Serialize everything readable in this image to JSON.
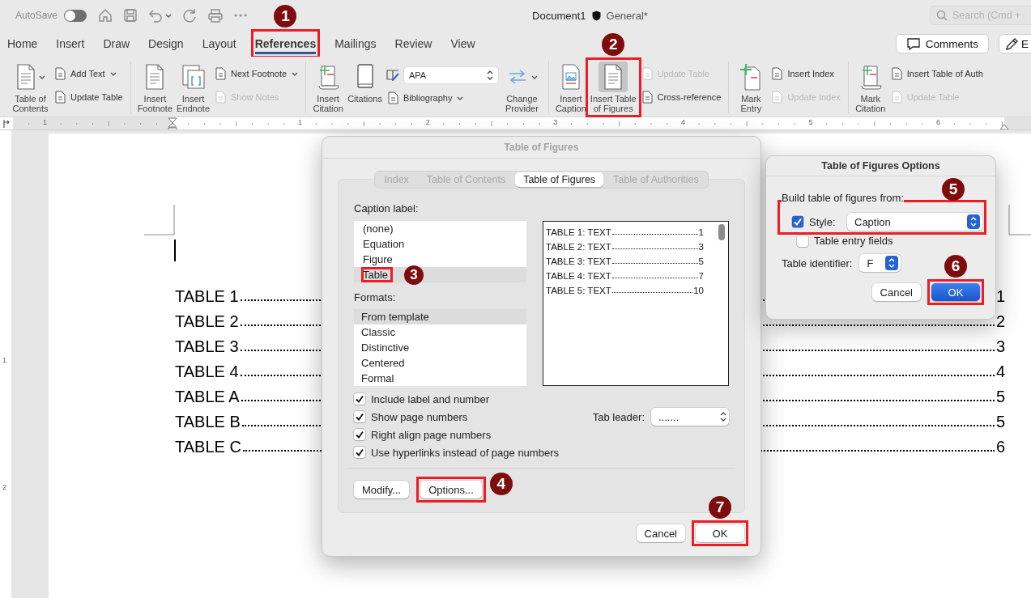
{
  "title_bar": {
    "autosave_label": "AutoSave",
    "autosave_on": false,
    "document_name": "Document1",
    "sensitivity": "General*",
    "search_placeholder": "Search (Cmd +"
  },
  "tabs": [
    {
      "label": "Home",
      "selected": false
    },
    {
      "label": "Insert",
      "selected": false
    },
    {
      "label": "Draw",
      "selected": false
    },
    {
      "label": "Design",
      "selected": false
    },
    {
      "label": "Layout",
      "selected": false
    },
    {
      "label": "References",
      "selected": true,
      "annotation": {
        "number": "1"
      }
    },
    {
      "label": "Mailings",
      "selected": false
    },
    {
      "label": "Review",
      "selected": false
    },
    {
      "label": "View",
      "selected": false
    }
  ],
  "header_buttons": [
    {
      "kind": "comments",
      "label": "Comments"
    },
    {
      "kind": "edit",
      "label": "E"
    }
  ],
  "ribbon": {
    "groups": [
      {
        "columns": [
          {
            "kind": "large",
            "label": "Table of\nContents",
            "caret": true,
            "selected": false
          },
          {
            "kind": "stack",
            "items": [
              {
                "kind": "button",
                "label": "Add Text",
                "caret": true,
                "disabled": false
              },
              {
                "kind": "button",
                "label": "Update Table",
                "caret": false,
                "disabled": false
              }
            ]
          }
        ]
      },
      {
        "columns": [
          {
            "kind": "large",
            "label": "Insert\nFootnote",
            "caret": false,
            "selected": false
          },
          {
            "kind": "large",
            "label": "Insert\nEndnote",
            "caret": false,
            "selected": false
          },
          {
            "kind": "stack",
            "items": [
              {
                "kind": "button",
                "label": "Next Footnote",
                "caret": true,
                "disabled": false
              },
              {
                "kind": "button",
                "label": "Show Notes",
                "caret": false,
                "disabled": true
              }
            ]
          }
        ]
      },
      {
        "columns": [
          {
            "kind": "large",
            "label": "Insert\nCitation",
            "caret": false,
            "selected": false
          },
          {
            "kind": "large",
            "label": "Citations",
            "caret": false,
            "selected": false
          },
          {
            "kind": "stack",
            "items": [
              {
                "kind": "select",
                "value": "APA"
              },
              {
                "kind": "button",
                "label": "Bibliography",
                "caret": true,
                "disabled": false
              }
            ]
          },
          {
            "kind": "large",
            "label": "Change\nProvider",
            "caret": true,
            "selected": false
          }
        ]
      },
      {
        "columns": [
          {
            "kind": "large",
            "label": "Insert\nCaption",
            "caret": false,
            "selected": false
          },
          {
            "kind": "large",
            "label": "Insert Table\nof Figures",
            "caret": false,
            "selected": true,
            "annotation": {
              "number": "2"
            }
          },
          {
            "kind": "stack",
            "items": [
              {
                "kind": "button",
                "label": "Update Table",
                "caret": false,
                "disabled": true
              },
              {
                "kind": "button",
                "label": "Cross-reference",
                "caret": false,
                "disabled": false
              }
            ]
          }
        ]
      },
      {
        "columns": [
          {
            "kind": "large",
            "label": "Mark\nEntry",
            "caret": false,
            "selected": false
          },
          {
            "kind": "stack",
            "items": [
              {
                "kind": "button",
                "label": "Insert Index",
                "caret": false,
                "disabled": false
              },
              {
                "kind": "button",
                "label": "Update Index",
                "caret": false,
                "disabled": true
              }
            ]
          }
        ]
      },
      {
        "columns": [
          {
            "kind": "large",
            "label": "Mark\nCitation",
            "caret": false,
            "selected": false
          },
          {
            "kind": "stack",
            "items": [
              {
                "kind": "button",
                "label": "Insert Table of Auth",
                "caret": false,
                "disabled": false
              },
              {
                "kind": "button",
                "label": "Update Table",
                "caret": false,
                "disabled": true
              }
            ]
          }
        ]
      }
    ]
  },
  "ruler": {
    "labels": [
      "1",
      "1",
      "2",
      "3",
      "4",
      "5",
      "6"
    ]
  },
  "vertical_ruler": {
    "labels": [
      "1",
      "2"
    ]
  },
  "document": {
    "entries": [
      {
        "label": "TABLE 1",
        "page": "1"
      },
      {
        "label": "TABLE 2",
        "page": "2"
      },
      {
        "label": "TABLE 3",
        "page": "3"
      },
      {
        "label": "TABLE 4",
        "page": "4"
      },
      {
        "label": "TABLE A",
        "page": "5"
      },
      {
        "label": "TABLE B",
        "page": "5"
      },
      {
        "label": "TABLE C",
        "page": "6"
      }
    ]
  },
  "dialog": {
    "title": "Table of Figures",
    "tabs": [
      {
        "label": "Index",
        "selected": false
      },
      {
        "label": "Table of Contents",
        "selected": false
      },
      {
        "label": "Table of Figures",
        "selected": true
      },
      {
        "label": "Table of Authorities",
        "selected": false
      }
    ],
    "caption_label": "Caption label:",
    "caption_items": [
      {
        "label": "(none)",
        "selected": false
      },
      {
        "label": "Equation",
        "selected": false
      },
      {
        "label": "Figure",
        "selected": false
      },
      {
        "label": "Table",
        "selected": true,
        "annotation": {
          "number": "3"
        }
      }
    ],
    "formats_label": "Formats:",
    "formats": [
      {
        "label": "From template",
        "selected": true
      },
      {
        "label": "Classic",
        "selected": false
      },
      {
        "label": "Distinctive",
        "selected": false
      },
      {
        "label": "Centered",
        "selected": false
      },
      {
        "label": "Formal",
        "selected": false
      }
    ],
    "preview": [
      {
        "label": "TABLE 1: TEXT",
        "page": "1"
      },
      {
        "label": "TABLE 2: TEXT",
        "page": "3"
      },
      {
        "label": "TABLE 3: TEXT",
        "page": "5"
      },
      {
        "label": "TABLE 4: TEXT",
        "page": "7"
      },
      {
        "label": "TABLE 5: TEXT",
        "page": "10"
      }
    ],
    "options": [
      {
        "label": "Include label and number",
        "checked": true
      },
      {
        "label": "Show page numbers",
        "checked": true
      },
      {
        "label": "Right align page numbers",
        "checked": true
      },
      {
        "label": "Use hyperlinks instead of page numbers",
        "checked": true
      }
    ],
    "tab_leader": {
      "label": "Tab leader:",
      "value": "......."
    },
    "buttons": [
      {
        "label": "Modify..."
      },
      {
        "label": "Options...",
        "annotation": {
          "number": "4"
        }
      }
    ],
    "footer_buttons": [
      {
        "label": "Cancel"
      },
      {
        "label": "OK",
        "annotation": {
          "number": "7"
        }
      }
    ]
  },
  "options_dialog": {
    "title": "Table of Figures Options",
    "build_label": "Build table of figures from:",
    "style": {
      "checked": true,
      "label": "Style:",
      "value": "Caption",
      "annotation": {
        "number": "5"
      }
    },
    "entry_fields": {
      "checked": false,
      "label": "Table entry fields"
    },
    "identifier": {
      "label": "Table identifier:",
      "value": "F"
    },
    "buttons": [
      {
        "label": "Cancel",
        "default": false
      },
      {
        "label": "OK",
        "default": true,
        "annotation": {
          "number": "6"
        }
      }
    ]
  }
}
